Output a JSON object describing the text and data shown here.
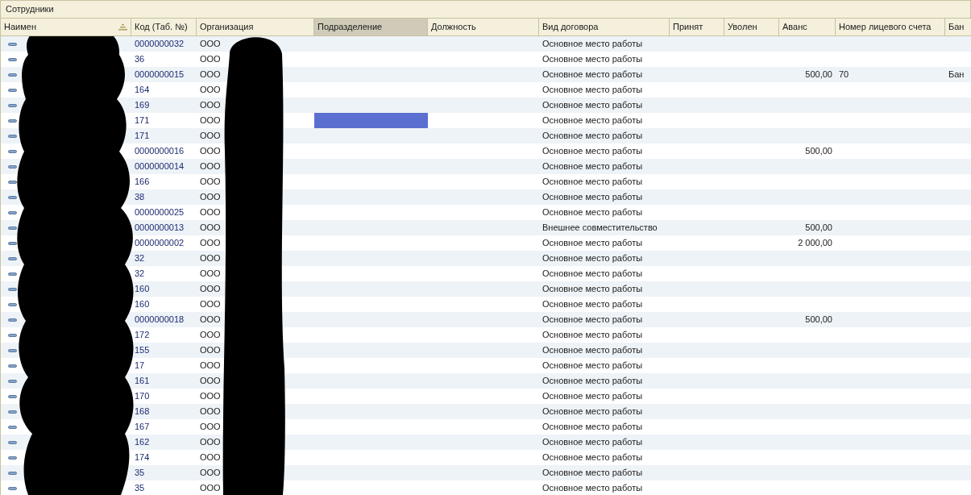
{
  "window": {
    "title": "Сотрудники"
  },
  "table": {
    "columns": [
      {
        "label": "Наимен",
        "sorted": true,
        "selected": false
      },
      {
        "label": "Код (Таб. №)",
        "sorted": false,
        "selected": false
      },
      {
        "label": "Организация",
        "sorted": false,
        "selected": false
      },
      {
        "label": "Подразделение",
        "sorted": false,
        "selected": true
      },
      {
        "label": "Должность",
        "sorted": false,
        "selected": false
      },
      {
        "label": "Вид договора",
        "sorted": false,
        "selected": false
      },
      {
        "label": "Принят",
        "sorted": false,
        "selected": false
      },
      {
        "label": "Уволен",
        "sorted": false,
        "selected": false
      },
      {
        "label": "Аванс",
        "sorted": false,
        "selected": false
      },
      {
        "label": "Номер лицевого счета",
        "sorted": false,
        "selected": false
      },
      {
        "label": "Бан",
        "sorted": false,
        "selected": false
      }
    ],
    "rows": [
      {
        "code": "0000000032",
        "org": "ООО",
        "contract": "Основное место работы",
        "selected": false
      },
      {
        "code": "36",
        "org": "ООО",
        "contract": "Основное место работы",
        "selected": false
      },
      {
        "code": "0000000015",
        "org": "ООО",
        "contract": "Основное место работы",
        "advance": "500,00",
        "account": "70",
        "bank": "Бан",
        "selected": false
      },
      {
        "code": "164",
        "org": "ООО",
        "contract": "Основное место работы",
        "selected": false
      },
      {
        "code": "169",
        "org": "ООО",
        "contract": "Основное место работы",
        "selected": false
      },
      {
        "code": "171",
        "org": "ООО",
        "contract": "Основное место работы",
        "selected": true
      },
      {
        "code": "171",
        "org": "ООО",
        "contract": "Основное место работы",
        "selected": false
      },
      {
        "code": "0000000016",
        "org": "ООО",
        "contract": "Основное место работы",
        "advance": "500,00",
        "selected": false
      },
      {
        "code": "0000000014",
        "org": "ООО",
        "contract": "Основное место работы",
        "selected": false
      },
      {
        "code": "166",
        "org": "ООО",
        "contract": "Основное место работы",
        "selected": false
      },
      {
        "code": "38",
        "org": "ООО",
        "contract": "Основное место работы",
        "selected": false
      },
      {
        "code": "0000000025",
        "org": "ООО",
        "contract": "Основное место работы",
        "selected": false
      },
      {
        "code": "0000000013",
        "org": "ООО",
        "contract": "Внешнее совместительство",
        "advance": "500,00",
        "selected": false
      },
      {
        "code": "0000000002",
        "org": "ООО",
        "contract": "Основное место работы",
        "advance": "2 000,00",
        "selected": false
      },
      {
        "code": "32",
        "org": "ООО",
        "contract": "Основное место работы",
        "selected": false
      },
      {
        "code": "32",
        "org": "ООО",
        "contract": "Основное место работы",
        "selected": false
      },
      {
        "code": "160",
        "org": "ООО",
        "contract": "Основное место работы",
        "selected": false
      },
      {
        "code": "160",
        "org": "ООО",
        "contract": "Основное место работы",
        "selected": false
      },
      {
        "code": "0000000018",
        "org": "ООО",
        "contract": "Основное место работы",
        "advance": "500,00",
        "selected": false
      },
      {
        "code": "172",
        "org": "ООО",
        "contract": "Основное место работы",
        "selected": false
      },
      {
        "code": "155",
        "org": "ООО",
        "contract": "Основное место работы",
        "selected": false
      },
      {
        "code": "17",
        "org": "ООО",
        "contract": "Основное место работы",
        "selected": false
      },
      {
        "code": "161",
        "org": "ООО",
        "contract": "Основное место работы",
        "selected": false
      },
      {
        "code": "170",
        "org": "ООО",
        "contract": "Основное место работы",
        "selected": false
      },
      {
        "code": "168",
        "org": "ООО",
        "contract": "Основное место работы",
        "selected": false
      },
      {
        "code": "167",
        "org": "ООО",
        "contract": "Основное место работы",
        "selected": false
      },
      {
        "code": "162",
        "org": "ООО",
        "contract": "Основное место работы",
        "selected": false
      },
      {
        "code": "174",
        "org": "ООО",
        "contract": "Основное место работы",
        "selected": false
      },
      {
        "code": "35",
        "org": "ООО",
        "contract": "Основное место работы",
        "selected": false
      },
      {
        "code": "35",
        "org": "ООО",
        "contract": "Основное место работы",
        "selected": false
      }
    ]
  }
}
